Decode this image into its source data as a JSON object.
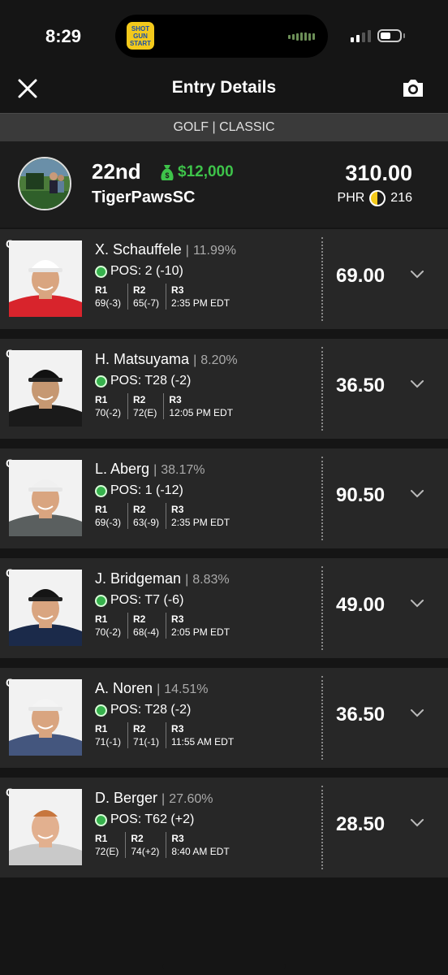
{
  "status": {
    "time": "8:29",
    "island_logo": "SHOTGUN START"
  },
  "header": {
    "title": "Entry Details"
  },
  "subbar": {
    "label": "GOLF | CLASSIC"
  },
  "summary": {
    "rank": "22nd",
    "prize": "$12,000",
    "username": "TigerPawsSC",
    "score": "310.00",
    "phr_label": "PHR",
    "phr_value": "216",
    "prize_color": "#3ec34a"
  },
  "players": [
    {
      "pos_tag": "G",
      "name": "X. Schauffele",
      "pct": "11.99%",
      "position": "POS: 2 (-10)",
      "rounds": [
        {
          "label": "R1",
          "value": "69(-3)"
        },
        {
          "label": "R2",
          "value": "65(-7)"
        },
        {
          "label": "R3",
          "value": "2:35 PM EDT"
        }
      ],
      "points": "69.00",
      "shirt": "#d8242c",
      "cap": "#ffffff"
    },
    {
      "pos_tag": "G",
      "name": "H. Matsuyama",
      "pct": "8.20%",
      "position": "POS: T28 (-2)",
      "rounds": [
        {
          "label": "R1",
          "value": "70(-2)"
        },
        {
          "label": "R2",
          "value": "72(E)"
        },
        {
          "label": "R3",
          "value": "12:05 PM EDT"
        }
      ],
      "points": "36.50",
      "shirt": "#1a1a1a",
      "cap": "#111111"
    },
    {
      "pos_tag": "G",
      "name": "L. Aberg",
      "pct": "38.17%",
      "position": "POS: 1 (-12)",
      "rounds": [
        {
          "label": "R1",
          "value": "69(-3)"
        },
        {
          "label": "R2",
          "value": "63(-9)"
        },
        {
          "label": "R3",
          "value": "2:35 PM EDT"
        }
      ],
      "points": "90.50",
      "shirt": "#5a5f5f",
      "cap": "#f0f0f0"
    },
    {
      "pos_tag": "G",
      "name": "J. Bridgeman",
      "pct": "8.83%",
      "position": "POS: T7 (-6)",
      "rounds": [
        {
          "label": "R1",
          "value": "70(-2)"
        },
        {
          "label": "R2",
          "value": "68(-4)"
        },
        {
          "label": "R3",
          "value": "2:05 PM EDT"
        }
      ],
      "points": "49.00",
      "shirt": "#1b2a4a",
      "cap": "#151515"
    },
    {
      "pos_tag": "G",
      "name": "A. Noren",
      "pct": "14.51%",
      "position": "POS: T28 (-2)",
      "rounds": [
        {
          "label": "R1",
          "value": "71(-1)"
        },
        {
          "label": "R2",
          "value": "71(-1)"
        },
        {
          "label": "R3",
          "value": "11:55 AM EDT"
        }
      ],
      "points": "36.50",
      "shirt": "#44567e",
      "cap": "#f4f4f4"
    },
    {
      "pos_tag": "G",
      "name": "D. Berger",
      "pct": "27.60%",
      "position": "POS: T62 (+2)",
      "rounds": [
        {
          "label": "R1",
          "value": "72(E)"
        },
        {
          "label": "R2",
          "value": "74(+2)"
        },
        {
          "label": "R3",
          "value": "8:40 AM EDT"
        }
      ],
      "points": "28.50",
      "shirt": "#c9c9c9",
      "cap": ""
    }
  ]
}
